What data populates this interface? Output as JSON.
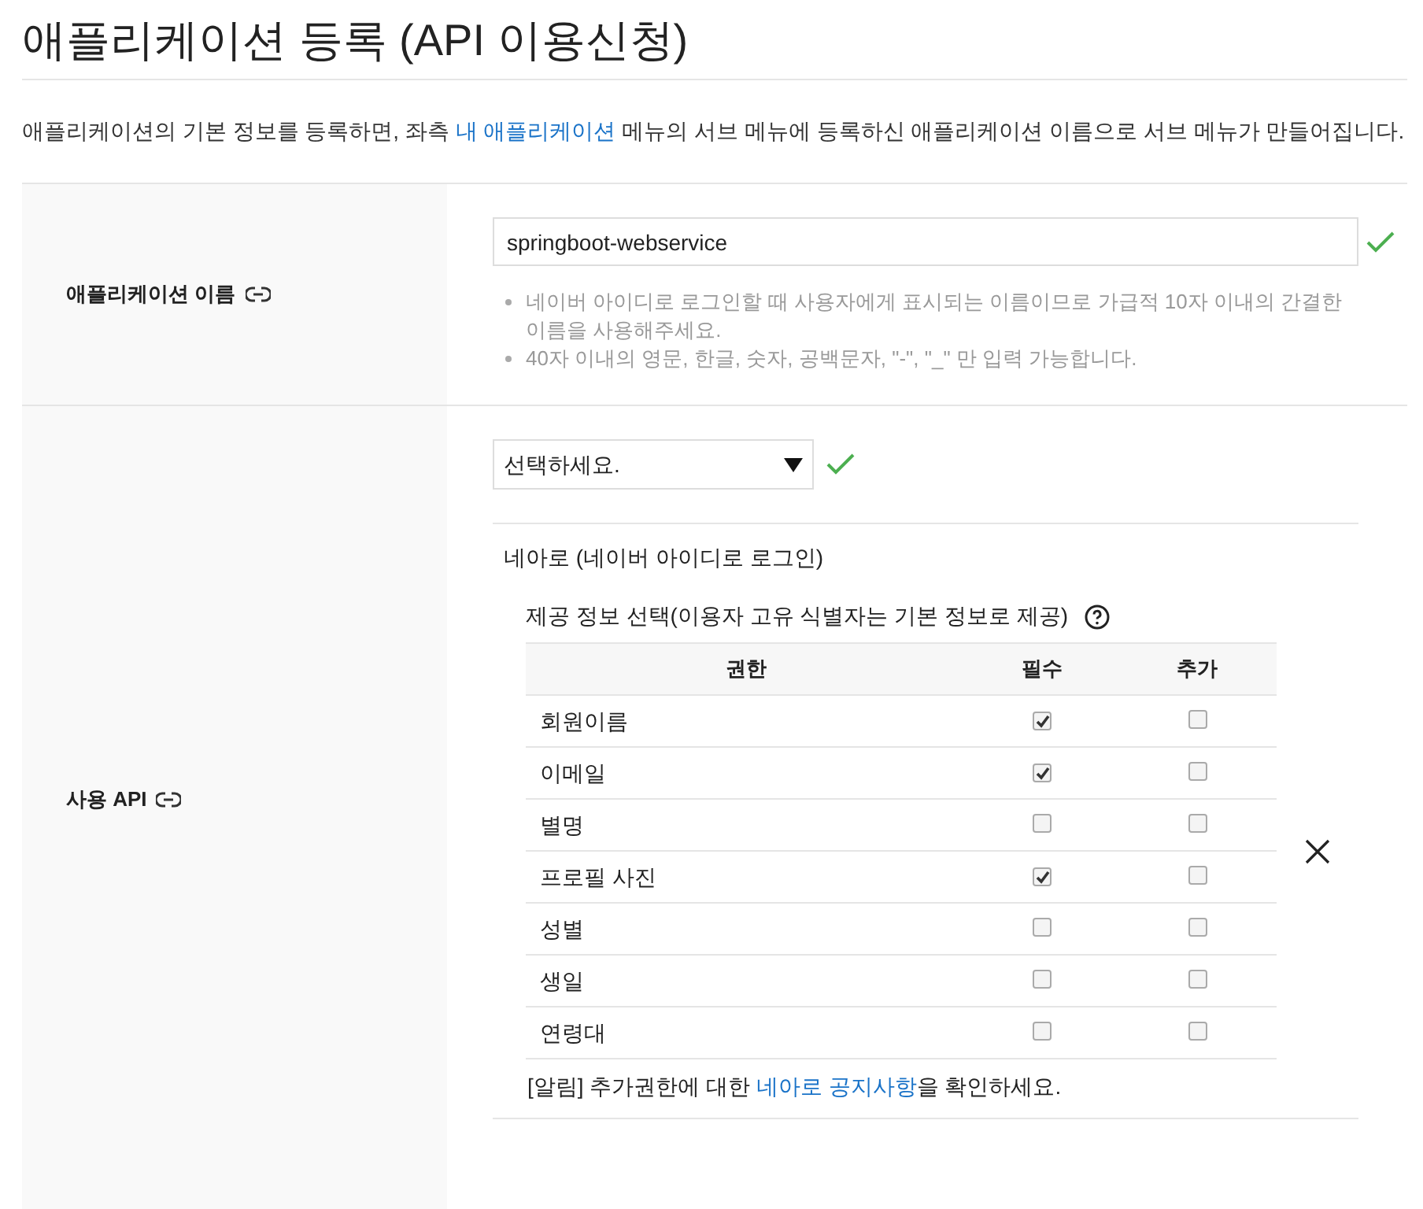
{
  "title": "애플리케이션 등록 (API 이용신청)",
  "description": {
    "before": "애플리케이션의 기본 정보를 등록하면, 좌측 ",
    "link": "내 애플리케이션",
    "after": " 메뉴의 서브 메뉴에 등록하신 애플리케이션 이름으로 서브 메뉴가 만들어집니다."
  },
  "app_name": {
    "label": "애플리케이션 이름",
    "value": "springboot-webservice",
    "valid": true,
    "hints": [
      "네이버 아이디로 로그인할 때 사용자에게 표시되는 이름이므로 가급적 10자 이내의 간결한 이름을 사용해주세요.",
      "40자 이내의 영문, 한글, 숫자, 공백문자, \"-\", \"_\" 만 입력 가능합니다."
    ]
  },
  "api": {
    "label": "사용 API",
    "select": {
      "value": "선택하세요.",
      "valid": true
    },
    "section_title": "네아로 (네이버 아이디로 로그인)",
    "subheading": "제공 정보 선택(이용자 고유 식별자는 기본 정보로 제공)",
    "columns": [
      "권한",
      "필수",
      "추가"
    ],
    "rows": [
      {
        "name": "회원이름",
        "required": true,
        "optional": false
      },
      {
        "name": "이메일",
        "required": true,
        "optional": false
      },
      {
        "name": "별명",
        "required": false,
        "optional": false
      },
      {
        "name": "프로필 사진",
        "required": true,
        "optional": false
      },
      {
        "name": "성별",
        "required": false,
        "optional": false
      },
      {
        "name": "생일",
        "required": false,
        "optional": false
      },
      {
        "name": "연령대",
        "required": false,
        "optional": false
      }
    ],
    "notice": {
      "before": "[알림] 추가권한에 대한 ",
      "link": "네아로 공지사항",
      "after": "을 확인하세요."
    }
  }
}
